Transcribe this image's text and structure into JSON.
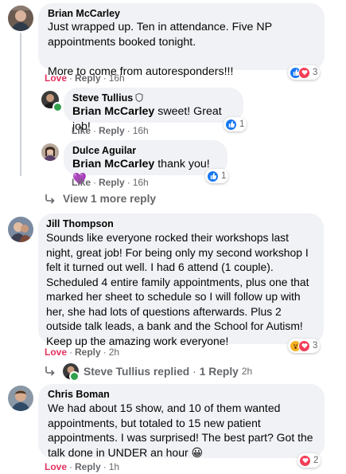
{
  "comments": [
    {
      "author": "Brian McCarley",
      "lines": [
        "Just wrapped up. Ten in attendance. Five NP",
        "appointments booked tonight.",
        "",
        "More to come from autoresponders!!!"
      ],
      "like_label": "Love",
      "reply_label": "Reply",
      "time": "16h",
      "reaction_icons": [
        "like",
        "love"
      ],
      "reaction_count": "3"
    },
    {
      "author": "Jill Thompson",
      "lines": [
        "Sounds like everyone rocked their workshops last",
        "night, great job! For being only my second workshop I",
        "felt it turned out well. I had 6 attend (1 couple).",
        "Scheduled 4 entire family appointments, plus one that",
        "marked her sheet to schedule so I will follow up with",
        "her, she had lots of questions afterwards. Plus 2",
        "outside talk leads, a bank and the School for Autism!",
        "Keep up the amazing work everyone!"
      ],
      "like_label": "Love",
      "reply_label": "Reply",
      "time": "2h",
      "reaction_icons": [
        "wow",
        "love"
      ],
      "reaction_count": "3"
    },
    {
      "author": "Chris Boman",
      "lines": [
        "We had about 15 show, and 10 of them wanted",
        "appointments, but totaled to 15 new patient",
        "appointments. I was surprised! The best part? Got the",
        "talk done in UNDER an hour 😀"
      ],
      "like_label": "Love",
      "reply_label": "Reply",
      "time": "1h",
      "reaction_icons": [
        "love"
      ],
      "reaction_count": "2"
    }
  ],
  "replies": [
    {
      "author": "Steve Tullius",
      "author_badge": "shield-icon",
      "mention": "Brian McCarley",
      "text": " sweet! Great job!",
      "like_label": "Like",
      "reply_label": "Reply",
      "time": "16h",
      "reaction_icons": [
        "like"
      ],
      "reaction_count": "1"
    },
    {
      "author": "Dulce Aguilar",
      "mention": "Brian McCarley",
      "text": " thank you! 💜",
      "like_label": "Like",
      "reply_label": "Reply",
      "time": "16h",
      "reaction_icons": [
        "like"
      ],
      "reaction_count": "1"
    }
  ],
  "view_more": "View 1 more reply",
  "replied_summary": {
    "author": "Steve Tullius",
    "action": " replied",
    "count": "1 Reply",
    "time": "2h"
  },
  "colors": {
    "bubble": "#f0f2f5",
    "love": "#e4325f",
    "meta": "#65676b",
    "like_blue": "#1877f2",
    "online": "#31a24c"
  }
}
